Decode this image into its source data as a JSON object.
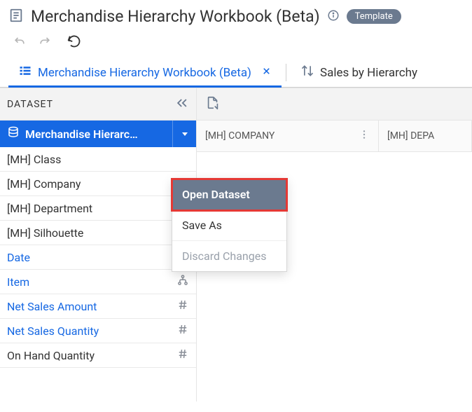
{
  "header": {
    "title": "Merchandise Hierarchy Workbook (Beta)",
    "badge": "Template"
  },
  "tabs": [
    {
      "label": "Merchandise Hierarchy Workbook (Beta)",
      "active": true
    },
    {
      "label": "Sales by Hierarchy",
      "active": false
    }
  ],
  "sidebar": {
    "title": "DATASET",
    "dataset_label": "Merchandise Hierarc…",
    "fields": [
      {
        "name": "[MH] Class",
        "icon": null,
        "link": false
      },
      {
        "name": "[MH] Company",
        "icon": null,
        "link": false
      },
      {
        "name": "[MH] Department",
        "icon": null,
        "link": false
      },
      {
        "name": "[MH] Silhouette",
        "icon": null,
        "link": false
      },
      {
        "name": "Date",
        "icon": "calendar",
        "link": true
      },
      {
        "name": "Item",
        "icon": "hierarchy",
        "link": true
      },
      {
        "name": "Net Sales Amount",
        "icon": "hash",
        "link": true
      },
      {
        "name": "Net Sales Quantity",
        "icon": "hash",
        "link": true
      },
      {
        "name": "On Hand Quantity",
        "icon": "hash",
        "link": false
      }
    ]
  },
  "menu": {
    "items": [
      {
        "label": "Open Dataset",
        "state": "highlight"
      },
      {
        "label": "Save As",
        "state": "normal"
      },
      {
        "label": "Discard Changes",
        "state": "disabled"
      }
    ]
  },
  "columns": [
    {
      "label": "[MH] COMPANY"
    },
    {
      "label": "[MH] DEPA"
    }
  ]
}
